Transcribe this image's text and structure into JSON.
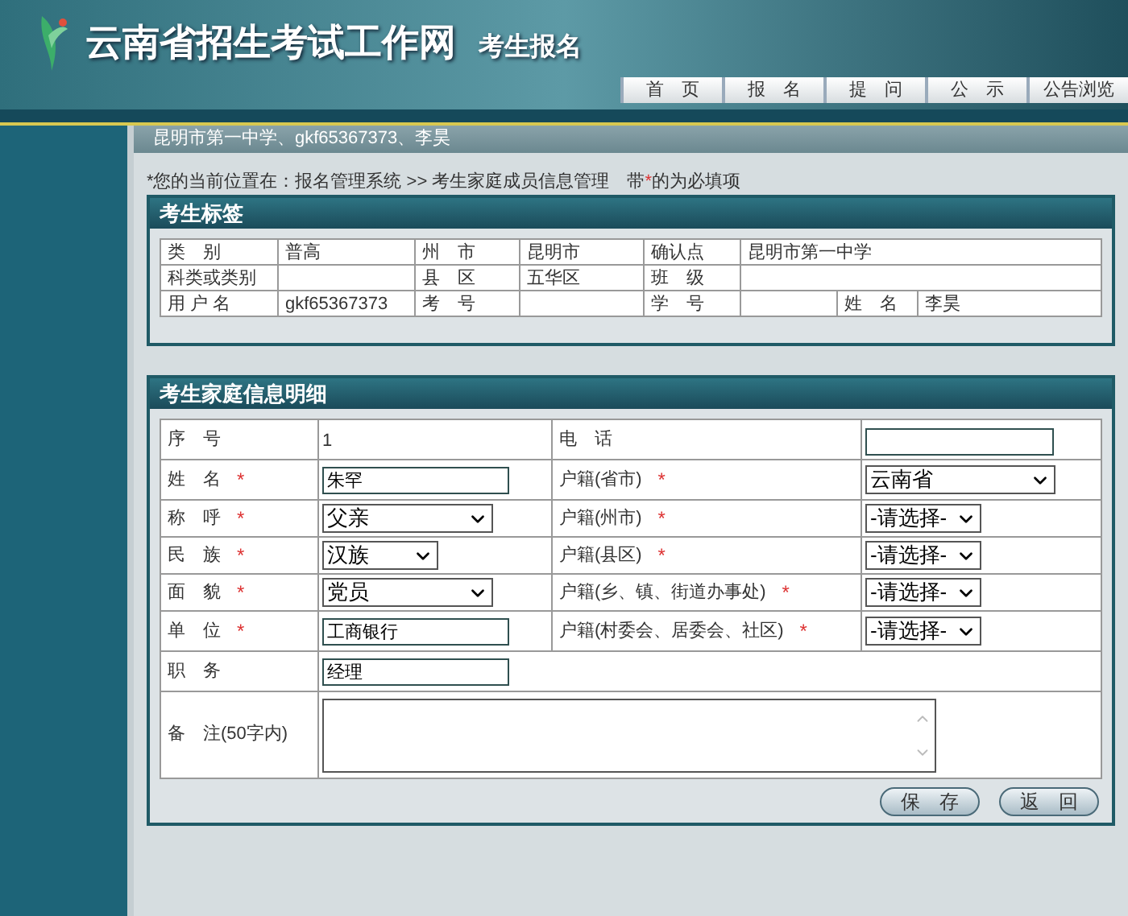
{
  "header": {
    "title": "云南省招生考试工作网",
    "subtitle": "考生报名",
    "nav": [
      {
        "label": "首　页",
        "selected": false
      },
      {
        "label": "报　名",
        "selected": false
      },
      {
        "label": "提　问",
        "selected": false
      },
      {
        "label": "公　示",
        "selected": false
      },
      {
        "label": "公告浏览",
        "selected": false
      }
    ]
  },
  "user_bar": "昆明市第一中学、gkf65367373、李昊",
  "breadcrumb": {
    "location": "*您的当前位置在：报名管理系统 >> 考生家庭成员信息管理",
    "note_before": "带",
    "note_mark": "*",
    "note_after": "的为必填项"
  },
  "student_panel": {
    "title": "考生标签",
    "rows": [
      [
        {
          "label": "类　别",
          "value": "普高"
        },
        {
          "label": "州　市",
          "value": "昆明市"
        },
        {
          "label": "确认点",
          "value": "昆明市第一中学"
        }
      ],
      [
        {
          "label": "科类或类别"
        },
        {
          "label": "县　区",
          "value": "五华区"
        },
        {
          "label": "班　级"
        }
      ],
      [
        {
          "label": "用 户 名",
          "value": "gkf65367373"
        },
        {
          "label": "考　号"
        },
        {
          "label": "学　号"
        },
        {
          "label": "姓　名",
          "value": "李昊"
        }
      ]
    ]
  },
  "family_panel": {
    "title": "考生家庭信息明细",
    "rows": [
      [
        {
          "label": "序　号",
          "field": {
            "kind": "text",
            "value": "1"
          }
        },
        {
          "label": "电　话",
          "field": {
            "kind": "input"
          }
        }
      ],
      [
        {
          "label": "姓　名",
          "mark": "*",
          "field": {
            "kind": "input",
            "value": "朱罕"
          }
        },
        {
          "label": "户籍(省市)",
          "mark": "*",
          "field": {
            "kind": "select",
            "value": "云南省"
          }
        }
      ],
      [
        {
          "label": "称　呼",
          "mark": "*",
          "field": {
            "kind": "select",
            "value": "父亲"
          }
        },
        {
          "label": "户籍(州市)",
          "mark": "*",
          "field": {
            "kind": "select",
            "value": "-请选择-"
          }
        }
      ],
      [
        {
          "label": "民　族",
          "mark": "*",
          "field": {
            "kind": "select",
            "value": "汉族"
          }
        },
        {
          "label": "户籍(县区)",
          "mark": "*",
          "field": {
            "kind": "select",
            "value": "-请选择-"
          }
        }
      ],
      [
        {
          "label": "面　貌",
          "mark": "*",
          "field": {
            "kind": "select",
            "value": "党员"
          }
        },
        {
          "label": "户籍(乡、镇、街道办事处)",
          "mark": "*",
          "field": {
            "kind": "select",
            "value": "-请选择-"
          }
        }
      ],
      [
        {
          "label": "单　位",
          "mark": "*",
          "field": {
            "kind": "input",
            "value": "工商银行"
          }
        },
        {
          "label": "户籍(村委会、居委会、社区)",
          "mark": "*",
          "field": {
            "kind": "select",
            "value": "-请选择-"
          }
        }
      ],
      [
        {
          "label": "职　务",
          "field": {
            "kind": "input",
            "value": "经理"
          }
        }
      ],
      [
        {
          "label": "备　注(50字内)",
          "field": {
            "kind": "textarea"
          }
        }
      ]
    ],
    "buttons": [
      "保　存",
      "返　回"
    ]
  }
}
